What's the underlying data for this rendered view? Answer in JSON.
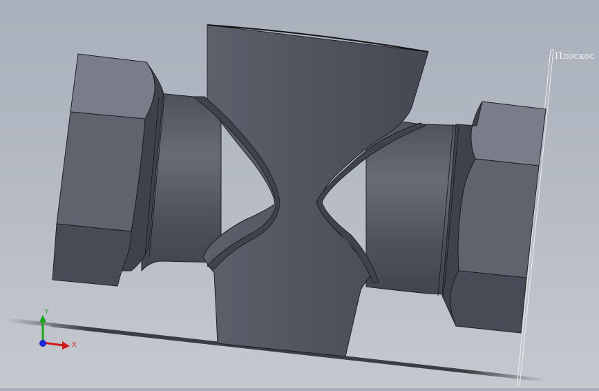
{
  "viewport": {
    "plane_label": "Плоскос",
    "triad": {
      "y_label": "Y",
      "x_label": "X"
    }
  },
  "colors": {
    "background_top": "#a9b0bb",
    "background_bottom": "#c5c8cf",
    "part_body": "#545964",
    "hex_face_light": "#787d89",
    "hex_face_dark": "#474b55",
    "edge": "#1d1f24",
    "axis_x": "#d11a1a",
    "axis_y": "#1aa51a",
    "axis_z": "#1a2ad1"
  },
  "icons": [
    "coordinate-triad-icon"
  ]
}
